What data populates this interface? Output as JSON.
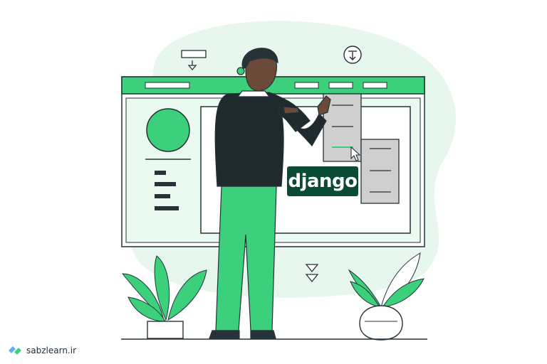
{
  "badge": {
    "text": "django"
  },
  "brand": {
    "name": "sabzlearn.ir"
  },
  "colors": {
    "accent": "#3ccf7c",
    "accent_light": "#e8f7ee",
    "django_green": "#0c4b33",
    "outline": "#263238",
    "panel_grey": "#cfcfcf"
  },
  "icons": [
    "download-circle-icon",
    "download-box-icon",
    "double-chevron-down-icon",
    "mouse-cursor-icon",
    "sabzlearn-logo-icon"
  ]
}
